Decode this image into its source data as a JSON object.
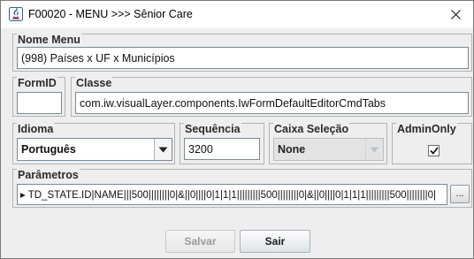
{
  "window": {
    "title": "F00020 - MENU >>> Sênior Care",
    "app_icon": "java-app-icon",
    "close_icon": "close-icon"
  },
  "nome_menu": {
    "label": "Nome Menu",
    "value": "(998) Países x UF x Municípios"
  },
  "form_id": {
    "label": "FormID",
    "value": ""
  },
  "classe": {
    "label": "Classe",
    "value": "com.iw.visualLayer.components.IwFormDefaultEditorCmdTabs"
  },
  "idioma": {
    "label": "Idioma",
    "value": "Português"
  },
  "sequencia": {
    "label": "Sequência",
    "value": "3200"
  },
  "caixa_selecao": {
    "label": "Caixa Seleção",
    "value": "None",
    "enabled": false
  },
  "admin_only": {
    "label": "AdminOnly",
    "checked": true
  },
  "parametros": {
    "label": "Parâmetros",
    "value": "TD_STATE.ID|NAME|||500||||||||0|&||0||||0|1|1|1|||||||||500||||||||0|&||0||||0|1|1|1|||||||||500||||||||0|",
    "browse_label": "..."
  },
  "buttons": {
    "save": "Salvar",
    "exit": "Sair"
  }
}
